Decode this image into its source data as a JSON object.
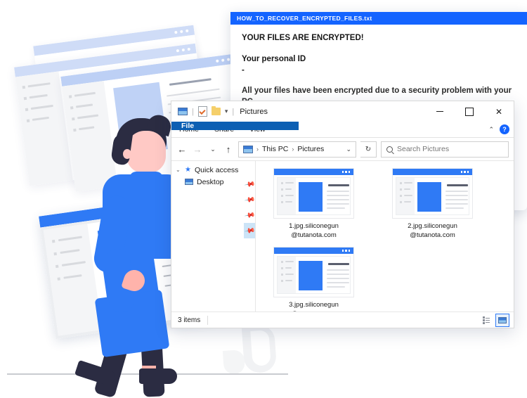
{
  "ransom_note": {
    "filename": "HOW_TO_RECOVER_ENCRYPTED_FILES.txt",
    "heading": "YOUR FILES ARE ENCRYPTED!",
    "personal_id_label": "Your personal ID",
    "personal_id_value": "-",
    "body_line": "All your files have been encrypted due to a security problem with your PC.",
    "title_bar_color": "#1464ff"
  },
  "explorer": {
    "title": "Pictures",
    "quick_access_icons": [
      "pictures-icon",
      "properties-icon",
      "folder-icon",
      "dropdown-caret"
    ],
    "window_controls": {
      "minimize": "–",
      "maximize": "☐",
      "close": "✕"
    },
    "ribbon_tabs": [
      {
        "label": "File",
        "active": true
      },
      {
        "label": "Home",
        "active": false
      },
      {
        "label": "Share",
        "active": false
      },
      {
        "label": "View",
        "active": false
      }
    ],
    "ribbon_collapse": "⌃",
    "help_label": "?",
    "nav": {
      "back": "←",
      "forward": "→",
      "recent": "⌄",
      "up": "↑",
      "refresh": "↻",
      "breadcrumb": [
        "This PC",
        "Pictures"
      ],
      "breadcrumb_separator": "›",
      "breadcrumb_dropdown": "⌄"
    },
    "search": {
      "placeholder": "Search Pictures",
      "icon": "search-icon"
    },
    "sidebar": [
      {
        "label": "Quick access",
        "icon": "star-icon",
        "expander": "⌄"
      },
      {
        "label": "Desktop",
        "icon": "desktop-icon",
        "pinned": true
      }
    ],
    "pins": [
      {
        "icon": "pin-icon",
        "selected": false
      },
      {
        "icon": "pin-icon",
        "selected": false
      },
      {
        "icon": "pin-icon",
        "selected": false
      },
      {
        "icon": "pin-icon",
        "selected": true
      }
    ],
    "files": [
      {
        "name_line1": "1.jpg.siliconegun",
        "name_line2": "@tutanota.com"
      },
      {
        "name_line2": "@tutanota.com",
        "name_line1": "2.jpg.siliconegun"
      },
      {
        "name_line1": "3.jpg.siliconegun",
        "name_line2": "@tutanota.com"
      }
    ],
    "status": {
      "item_count": "3 items"
    },
    "view_buttons": [
      {
        "name": "details-view",
        "selected": false
      },
      {
        "name": "large-icons-view",
        "selected": true
      }
    ]
  },
  "illustration": {
    "alt": "person carrying a browser window walking past stacked browser windows",
    "accent_color": "#2f7af5",
    "skin_color": "#ffc9c5",
    "hair_color": "#2b2c42"
  }
}
